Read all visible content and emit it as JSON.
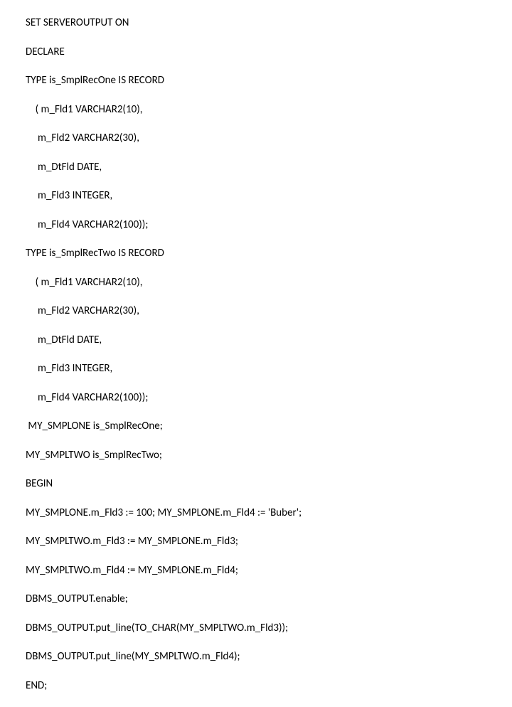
{
  "code": {
    "lines": [
      "SET SERVEROUTPUT ON",
      "DECLARE",
      "TYPE is_SmplRecOne IS RECORD",
      "    ( m_Fld1 VARCHAR2(10),",
      "     m_Fld2 VARCHAR2(30),",
      "     m_DtFld DATE,",
      "     m_Fld3 INTEGER,",
      "     m_Fld4 VARCHAR2(100));",
      "TYPE is_SmplRecTwo IS RECORD",
      "    ( m_Fld1 VARCHAR2(10),",
      "     m_Fld2 VARCHAR2(30),",
      "     m_DtFld DATE,",
      "     m_Fld3 INTEGER,",
      "     m_Fld4 VARCHAR2(100));",
      " MY_SMPLONE is_SmplRecOne;",
      "MY_SMPLTWO is_SmplRecTwo;",
      "BEGIN",
      "MY_SMPLONE.m_Fld3 := 100; MY_SMPLONE.m_Fld4 := 'Buber';",
      "MY_SMPLTWO.m_Fld3 := MY_SMPLONE.m_Fld3;",
      "MY_SMPLTWO.m_Fld4 := MY_SMPLONE.m_Fld4;",
      "DBMS_OUTPUT.enable;",
      "DBMS_OUTPUT.put_line(TO_CHAR(MY_SMPLTWO.m_Fld3));",
      "DBMS_OUTPUT.put_line(MY_SMPLTWO.m_Fld4);",
      "END;"
    ]
  }
}
